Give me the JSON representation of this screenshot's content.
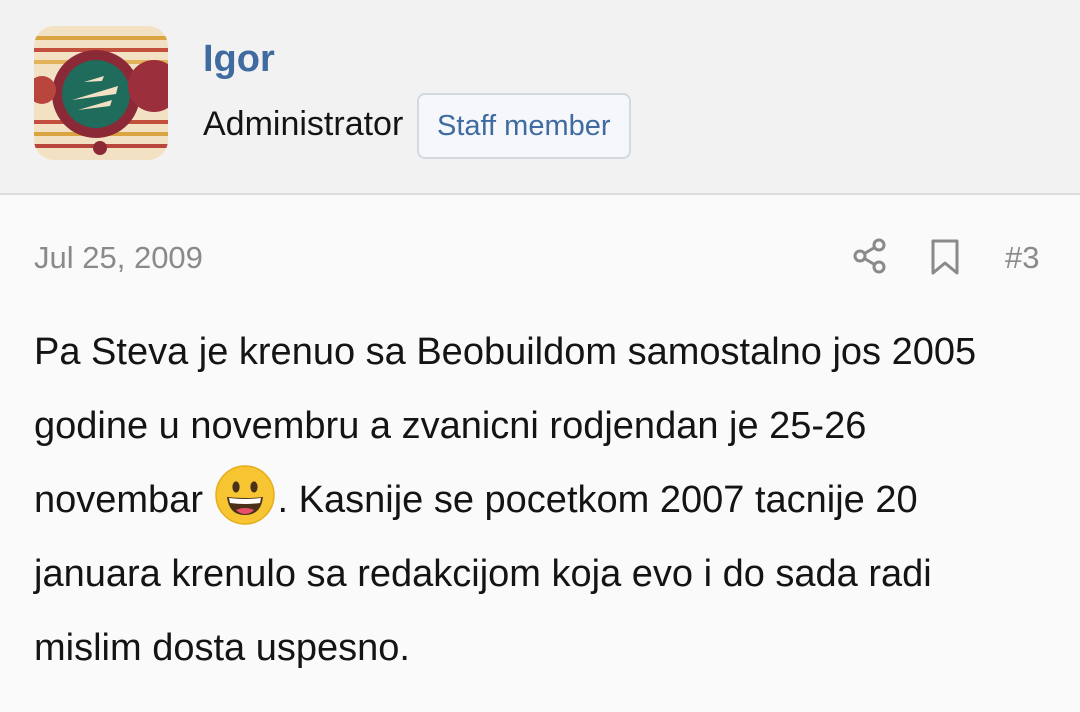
{
  "user": {
    "name": "Igor",
    "title": "Administrator",
    "badge": "Staff member"
  },
  "post": {
    "date": "Jul 25, 2009",
    "number": "#3",
    "body_part1": "Pa Steva je krenuo sa Beobuildom samostalno jos 2005 godine u novembru a zvanicni rodjendan je 25-26 novembar ",
    "emoji": "grinning-face",
    "body_part2": ". Kasnije se pocetkom 2007 tacnije 20 januara krenulo sa redakcijom koja evo i do sada radi mislim dosta uspesno."
  },
  "icons": {
    "share": "share-icon",
    "bookmark": "bookmark-icon"
  },
  "colors": {
    "username": "#3f6ba1",
    "header_bg": "#f2f2f2",
    "body_bg": "#fafafa",
    "meta_text": "#8a8a8a"
  }
}
